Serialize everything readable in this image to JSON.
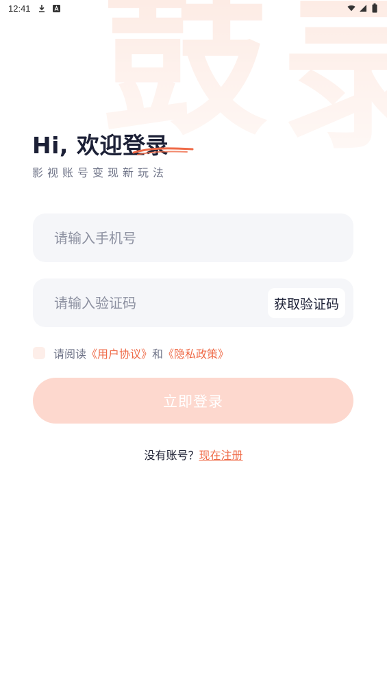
{
  "status_bar": {
    "time": "12:41",
    "icons": [
      "download-icon",
      "a-badge-icon",
      "wifi-icon",
      "signal-icon",
      "battery-icon"
    ]
  },
  "background": {
    "glyphs": [
      "鼓",
      "录"
    ]
  },
  "header": {
    "greeting_prefix": "Hi, 欢迎",
    "greeting_highlight": "登录",
    "subtitle": "影视账号变现新玩法"
  },
  "form": {
    "phone_placeholder": "请输入手机号",
    "phone_value": "",
    "code_placeholder": "请输入验证码",
    "code_value": "",
    "get_code_label": "获取验证码"
  },
  "agreement": {
    "checked": false,
    "prefix": "请阅读",
    "user_agreement": "《用户协议》",
    "connector": "和",
    "privacy_policy": "《隐私政策》"
  },
  "login_button_label": "立即登录",
  "register": {
    "prompt": "没有账号？",
    "link_label": "现在注册"
  },
  "colors": {
    "accent": "#ef6a47",
    "button_disabled": "#fdd8ce",
    "field_bg": "#f5f6f9",
    "title": "#1c2036"
  }
}
